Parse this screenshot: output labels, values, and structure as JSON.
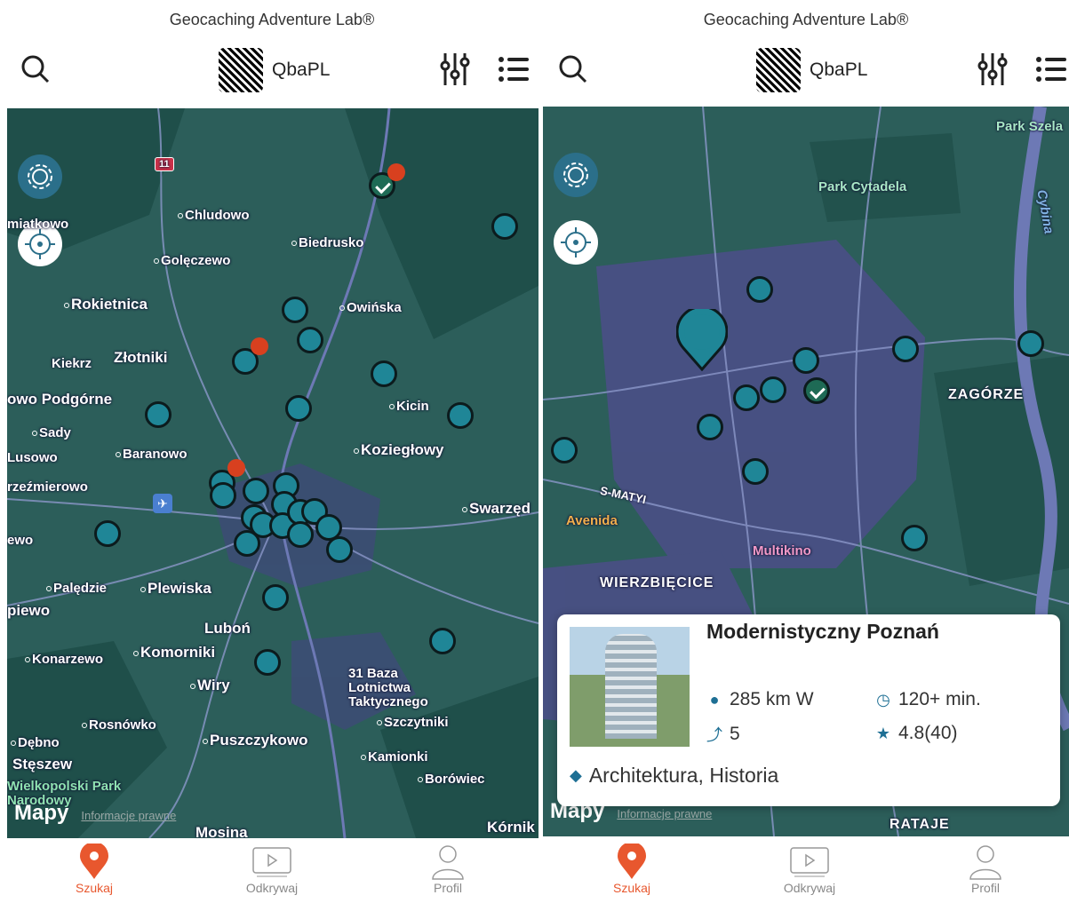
{
  "app_title": "Geocaching Adventure Lab®",
  "user": {
    "name": "QbaPL"
  },
  "tabs": [
    {
      "label": "Szukaj",
      "active": true
    },
    {
      "label": "Odkrywaj",
      "active": false
    },
    {
      "label": "Profil",
      "active": false
    }
  ],
  "colors": {
    "accent": "#e8572e",
    "pin": "#1f8697",
    "done_pin": "#1e6a55",
    "map_bg": "#2c5e5a"
  },
  "map_legal": {
    "brand": "Mapy",
    "legal_link": "Informacje prawne"
  },
  "left_map": {
    "labels": [
      "miatkowo",
      "Chludowo",
      "Biedrusko",
      "Golęczewo",
      "Rokietnica",
      "Owińska",
      "Kiekrz",
      "Złotniki",
      "owo Podgórne",
      "Kicin",
      "Sady",
      "Koziegłowy",
      "Lusowo",
      "Baranowo",
      "rzeźmierowo",
      "Swarzęd",
      "ewo",
      "Palędzie",
      "Plewiska",
      "piewo",
      "Luboń",
      "Konarzewo",
      "Komorniki",
      "Wiry",
      "31 Baza Lotnictwa Taktycznego",
      "Rosnówko",
      "Szczytniki",
      "Dębno",
      "Puszczykowo",
      "Kamionki",
      "Stęszew",
      "Borówiec",
      "Wielkopolski Park Narodowy",
      "Mosina",
      "Kórnik",
      "11"
    ]
  },
  "right_map": {
    "labels": [
      "Park Szela",
      "Park Cytadela",
      "Cybina",
      "ZAGÓRZE",
      "Avenida",
      "Multikino",
      "WIERZBIĘCICE",
      "RATAJE",
      "S-MATYI"
    ]
  },
  "card": {
    "title": "Modernistyczny Poznań",
    "distance": "285 km W",
    "duration": "120+ min.",
    "stages": "5",
    "rating": "4.8(40)",
    "tags": "Architektura, Historia"
  },
  "icons": [
    "search-icon",
    "filter-icon",
    "list-icon",
    "gear-icon",
    "locate-icon",
    "map-pin-icon",
    "play-icon",
    "person-icon",
    "thumbs-up-icon",
    "airport-icon",
    "location-icon",
    "clock-icon",
    "route-icon",
    "star-icon",
    "tag-icon"
  ]
}
